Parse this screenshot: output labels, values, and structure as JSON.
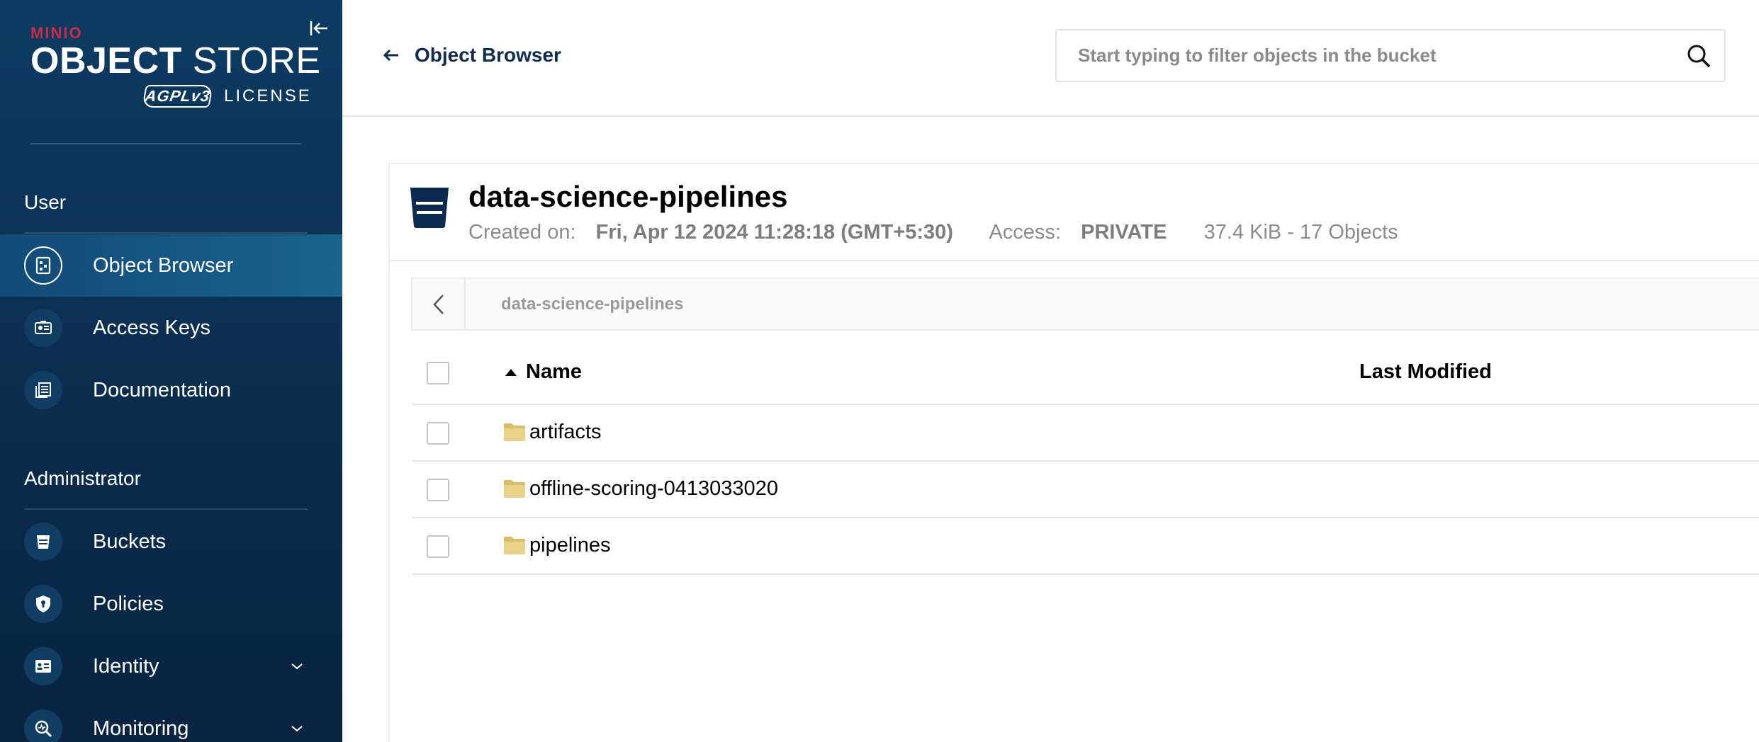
{
  "sidebar": {
    "logo": {
      "brand": "MINIO",
      "product_bold": "OBJECT",
      "product_light": " STORE",
      "badge": "AGPLv3",
      "license": "LICENSE"
    },
    "sections": [
      {
        "title": "User",
        "items": [
          {
            "label": "Object Browser",
            "icon": "object-browser-icon",
            "active": true
          },
          {
            "label": "Access Keys",
            "icon": "access-keys-icon"
          },
          {
            "label": "Documentation",
            "icon": "documentation-icon"
          }
        ]
      },
      {
        "title": "Administrator",
        "items": [
          {
            "label": "Buckets",
            "icon": "buckets-icon"
          },
          {
            "label": "Policies",
            "icon": "policies-icon"
          },
          {
            "label": "Identity",
            "icon": "identity-icon",
            "expandable": true
          },
          {
            "label": "Monitoring",
            "icon": "monitoring-icon",
            "expandable": true
          }
        ]
      }
    ]
  },
  "header": {
    "back_label": "Object Browser",
    "search_placeholder": "Start typing to filter objects in the bucket"
  },
  "bucket": {
    "name": "data-science-pipelines",
    "created_label": "Created on:",
    "created_value": "Fri, Apr 12 2024 11:28:18 (GMT+5:30)",
    "access_label": "Access:",
    "access_value": "PRIVATE",
    "size_summary": "37.4 KiB - 17 Objects"
  },
  "breadcrumb": "data-science-pipelines",
  "table": {
    "columns": {
      "name": "Name",
      "last_modified": "Last Modified"
    },
    "rows": [
      {
        "name": "artifacts",
        "type": "folder"
      },
      {
        "name": "offline-scoring-0413033020",
        "type": "folder"
      },
      {
        "name": "pipelines",
        "type": "folder"
      }
    ]
  },
  "colors": {
    "sidebar_bg": "#0b2c4d",
    "sidebar_active": "#175985",
    "brand_red": "#c72c48",
    "folder": "#e8d08a",
    "heading": "#0f2b4d"
  }
}
